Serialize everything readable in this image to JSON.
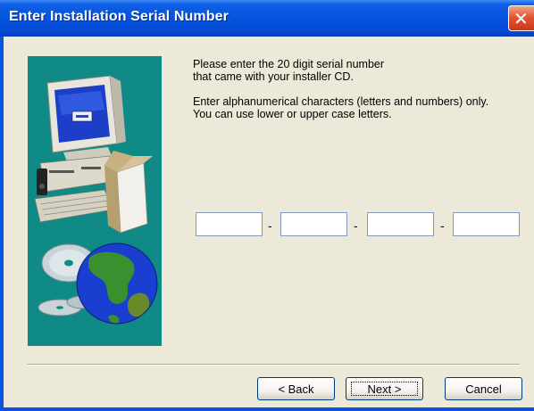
{
  "window": {
    "title": "Enter Installation Serial Number",
    "close_glyph": "✕"
  },
  "instructions": {
    "line1": "Please enter the 20 digit serial number",
    "line2": "that came with your installer CD.",
    "line3": "Enter alphanumerical characters (letters and numbers) only.",
    "line4": "You can use lower or upper case letters."
  },
  "serial_fields": [
    {
      "value": ""
    },
    {
      "value": ""
    },
    {
      "value": ""
    },
    {
      "value": ""
    }
  ],
  "separator_char": "-",
  "buttons": {
    "back": "< Back",
    "next": "Next >",
    "cancel": "Cancel"
  },
  "colors": {
    "titlebar": "#0553df",
    "art_panel": "#0f8a86",
    "dialog_bg": "#ece9d8",
    "close_button": "#e2552e"
  },
  "icons": [
    "computer-illustration",
    "cd-discs-icon",
    "globe-icon",
    "close-icon"
  ]
}
